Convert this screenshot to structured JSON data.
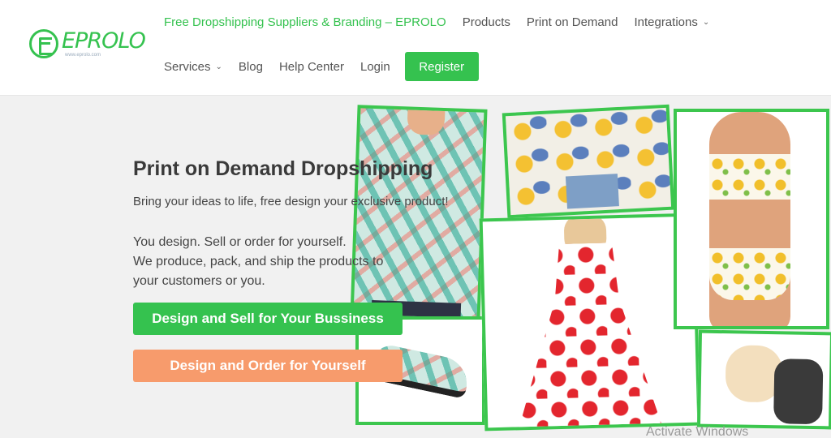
{
  "brand": {
    "logo_text": "EPROLO",
    "logo_sub": "www.eprolo.com"
  },
  "nav": {
    "row1": [
      {
        "label": "Free Dropshipping Suppliers & Branding – EPROLO",
        "active": true,
        "dropdown": false
      },
      {
        "label": "Products",
        "active": false,
        "dropdown": false
      },
      {
        "label": "Print on Demand",
        "active": false,
        "dropdown": false
      },
      {
        "label": "Integrations",
        "active": false,
        "dropdown": true
      }
    ],
    "row2": [
      {
        "label": "Services",
        "dropdown": true
      },
      {
        "label": "Blog",
        "dropdown": false
      },
      {
        "label": "Help Center",
        "dropdown": false
      },
      {
        "label": "Login",
        "dropdown": false
      }
    ],
    "register_label": "Register",
    "caret_glyph": "⌄"
  },
  "hero": {
    "title": "Print on Demand Dropshipping",
    "subtitle": "Bring your ideas to life, free design your exclusive product!",
    "desc_lines": [
      "You design. Sell or order for yourself.",
      "We produce, pack, and ship the products to",
      "your customers or you."
    ],
    "cta_sell": "Design and Sell for Your Bussiness",
    "cta_order": "Design and Order for Yourself"
  },
  "collage": {
    "tiles": [
      "hawaiian-shirt",
      "slip-on-shoe",
      "abstract-hoodie",
      "polka-dot-dress",
      "pineapple-bikini",
      "dog-harness"
    ]
  },
  "colors": {
    "accent": "#35c24f",
    "cta_secondary": "#f79b6c",
    "frame": "#3cc64e"
  },
  "system": {
    "watermark": "Activate Windows"
  }
}
